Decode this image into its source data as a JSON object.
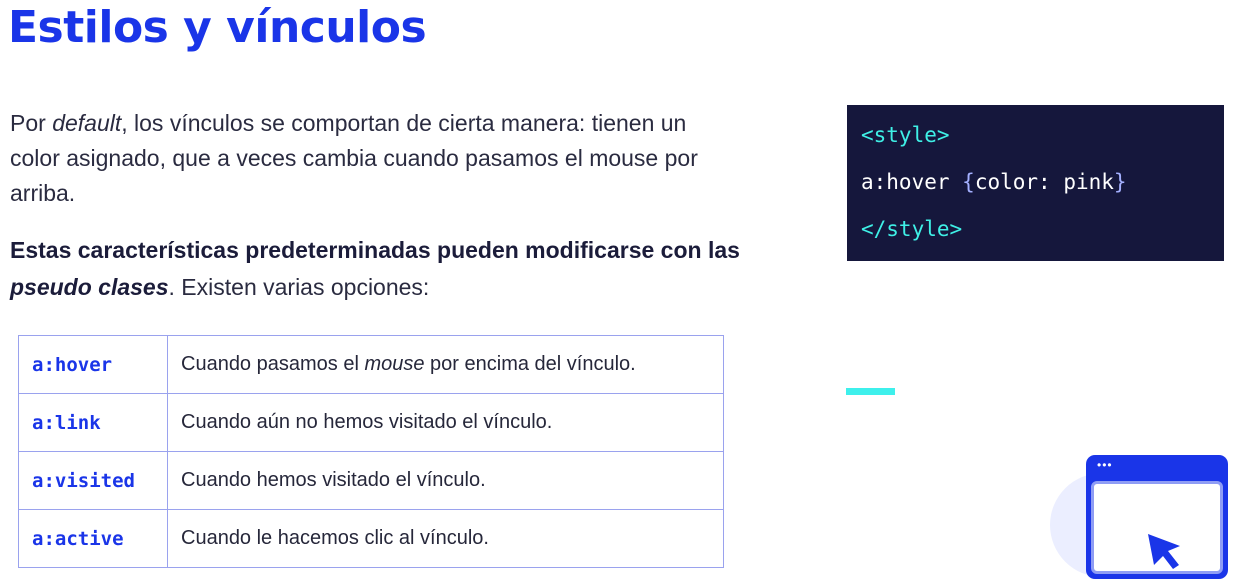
{
  "title": "Estilos y vínculos",
  "intro": {
    "text_before": "Por ",
    "emph": "default",
    "text_after": ", los vínculos se comportan de cierta manera: tienen un color asignado, que a veces cambia cuando pasamos el mouse por arriba."
  },
  "summary": {
    "bold_before": "Estas características predeterminadas pueden modificarse con las ",
    "bold_emph": "pseudo clases",
    "after": ". Existen varias opciones:"
  },
  "table": {
    "rows": [
      {
        "selector": "a:hover",
        "before": "Cuando pasamos el ",
        "emph": "mouse",
        "after": " por encima del vínculo."
      },
      {
        "selector": "a:link",
        "desc": "Cuando aún no hemos visitado el vínculo."
      },
      {
        "selector": "a:visited",
        "desc": "Cuando hemos visitado el vínculo."
      },
      {
        "selector": "a:active",
        "desc": "Cuando le hacemos clic al vínculo."
      }
    ]
  },
  "code": {
    "open_tag": "<style>",
    "rule_selector": "a:hover ",
    "brace_open": "{",
    "rule_body": "color: pink",
    "brace_close": "}",
    "close_tag": "</style>"
  },
  "illustration": {
    "icon": "browser-window-cursor-icon",
    "dots": "•••"
  },
  "colors": {
    "accent": "#1a35e8",
    "code_bg": "#15173c",
    "code_tag": "#3ff0e6",
    "table_border": "#9aa2ee",
    "bar": "#3ef0ec"
  }
}
